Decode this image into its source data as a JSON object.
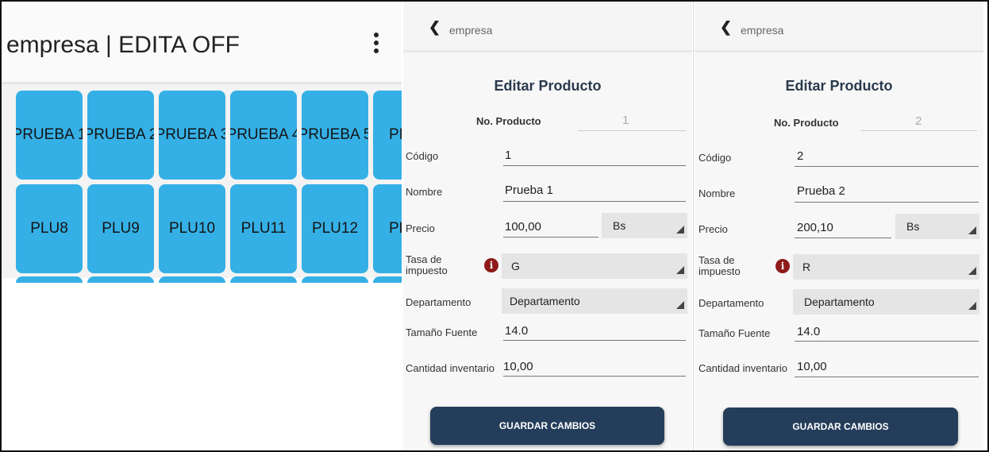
{
  "left": {
    "title": "empresa | EDITA OFF",
    "row1": [
      "PRUEBA 1",
      "PRUEBA 2",
      "PRUEBA 3",
      "PRUEBA 4",
      "PRUEBA 5",
      "PI"
    ],
    "row2": [
      "PLU8",
      "PLU9",
      "PLU10",
      "PLU11",
      "PLU12",
      "PL"
    ],
    "tile_color": "#35b0e6"
  },
  "forms": [
    {
      "nav_title": "empresa",
      "heading": "Editar Producto",
      "no_producto_label": "No. Producto",
      "no_producto": "1",
      "codigo_label": "Código",
      "codigo": "1",
      "nombre_label": "Nombre",
      "nombre": "Prueba 1",
      "precio_label": "Precio",
      "precio": "100,00",
      "moneda": "Bs",
      "tasa_label_1": "Tasa de",
      "tasa_label_2": "impuesto",
      "tasa": "G",
      "departamento_label": "Departamento",
      "departamento": "Departamento",
      "tamano_label": "Tamaño Fuente",
      "tamano": "14.0",
      "cantidad_label": "Cantidad inventario",
      "cantidad": "10,00",
      "save_label": "GUARDAR CAMBIOS"
    },
    {
      "nav_title": "empresa",
      "heading": "Editar Producto",
      "no_producto_label": "No. Producto",
      "no_producto": "2",
      "codigo_label": "Código",
      "codigo": "2",
      "nombre_label": "Nombre",
      "nombre": "Prueba 2",
      "precio_label": "Precio",
      "precio": "200,10",
      "moneda": "Bs",
      "tasa_label_1": "Tasa de",
      "tasa_label_2": "impuesto",
      "tasa": "R",
      "departamento_label": "Departamento",
      "departamento": "Departamento",
      "tamano_label": "Tamaño Fuente",
      "tamano": "14.0",
      "cantidad_label": "Cantidad inventario",
      "cantidad": "10,00",
      "save_label": "GUARDAR CAMBIOS"
    }
  ],
  "colors": {
    "button": "#243d5a",
    "info_icon": "#8f1a1a",
    "heading": "#2a3a4d"
  },
  "icons": [
    "more-vert-icon",
    "back-chevron-icon",
    "info-icon",
    "dropdown-arrow-icon"
  ]
}
